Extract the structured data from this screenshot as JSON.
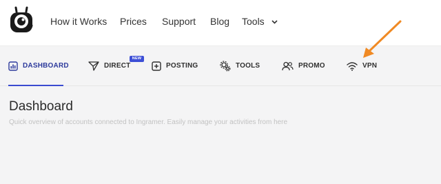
{
  "header": {
    "nav": [
      {
        "label": "How it Works"
      },
      {
        "label": "Prices"
      },
      {
        "label": "Support"
      },
      {
        "label": "Blog"
      }
    ],
    "tools_label": "Tools"
  },
  "tabs": [
    {
      "label": "DASHBOARD",
      "icon": "dashboard-icon",
      "active": true
    },
    {
      "label": "DIRECT",
      "icon": "send-icon",
      "badge": "NEW"
    },
    {
      "label": "POSTING",
      "icon": "plus-square-icon"
    },
    {
      "label": "TOOLS",
      "icon": "gears-icon"
    },
    {
      "label": "PROMO",
      "icon": "users-icon"
    },
    {
      "label": "VPN",
      "icon": "wifi-icon"
    }
  ],
  "page": {
    "title": "Dashboard",
    "subtitle": "Quick overview of accounts connected to Ingramer. Easily manage your activities from here"
  },
  "colors": {
    "accent": "#3a4bd0",
    "arrow": "#f08a24",
    "badge": "#3d4fd6"
  }
}
